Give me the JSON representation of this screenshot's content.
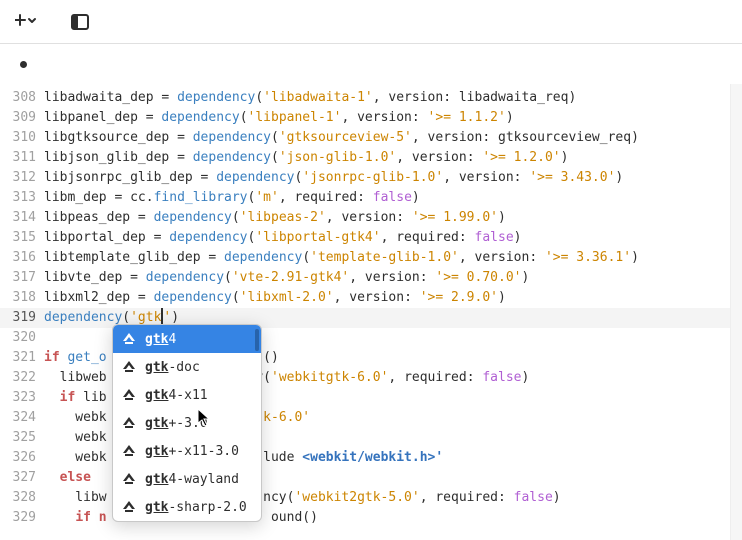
{
  "editor": {
    "lines": [
      {
        "num": 308,
        "tokens": [
          {
            "t": "ident",
            "v": "libadwaita_dep "
          },
          {
            "t": "p",
            "v": "= "
          },
          {
            "t": "fn",
            "v": "dependency"
          },
          {
            "t": "p",
            "v": "("
          },
          {
            "t": "s",
            "v": "'libadwaita-1'"
          },
          {
            "t": "p",
            "v": ", "
          },
          {
            "t": "arglabel",
            "v": "version"
          },
          {
            "t": "p",
            "v": ": "
          },
          {
            "t": "ident",
            "v": "libadwaita_req"
          },
          {
            "t": "p",
            "v": ")"
          }
        ]
      },
      {
        "num": 309,
        "tokens": [
          {
            "t": "ident",
            "v": "libpanel_dep "
          },
          {
            "t": "p",
            "v": "= "
          },
          {
            "t": "fn",
            "v": "dependency"
          },
          {
            "t": "p",
            "v": "("
          },
          {
            "t": "s",
            "v": "'libpanel-1'"
          },
          {
            "t": "p",
            "v": ", "
          },
          {
            "t": "arglabel",
            "v": "version"
          },
          {
            "t": "p",
            "v": ": "
          },
          {
            "t": "s",
            "v": "'>= 1.1.2'"
          },
          {
            "t": "p",
            "v": ")"
          }
        ]
      },
      {
        "num": 310,
        "tokens": [
          {
            "t": "ident",
            "v": "libgtksource_dep "
          },
          {
            "t": "p",
            "v": "= "
          },
          {
            "t": "fn",
            "v": "dependency"
          },
          {
            "t": "p",
            "v": "("
          },
          {
            "t": "s",
            "v": "'gtksourceview-5'"
          },
          {
            "t": "p",
            "v": ", "
          },
          {
            "t": "arglabel",
            "v": "version"
          },
          {
            "t": "p",
            "v": ": "
          },
          {
            "t": "ident",
            "v": "gtksourceview_req"
          },
          {
            "t": "p",
            "v": ")"
          }
        ]
      },
      {
        "num": 311,
        "tokens": [
          {
            "t": "ident",
            "v": "libjson_glib_dep "
          },
          {
            "t": "p",
            "v": "= "
          },
          {
            "t": "fn",
            "v": "dependency"
          },
          {
            "t": "p",
            "v": "("
          },
          {
            "t": "s",
            "v": "'json-glib-1.0'"
          },
          {
            "t": "p",
            "v": ", "
          },
          {
            "t": "arglabel",
            "v": "version"
          },
          {
            "t": "p",
            "v": ": "
          },
          {
            "t": "s",
            "v": "'>= 1.2.0'"
          },
          {
            "t": "p",
            "v": ")"
          }
        ]
      },
      {
        "num": 312,
        "tokens": [
          {
            "t": "ident",
            "v": "libjsonrpc_glib_dep "
          },
          {
            "t": "p",
            "v": "= "
          },
          {
            "t": "fn",
            "v": "dependency"
          },
          {
            "t": "p",
            "v": "("
          },
          {
            "t": "s",
            "v": "'jsonrpc-glib-1.0'"
          },
          {
            "t": "p",
            "v": ", "
          },
          {
            "t": "arglabel",
            "v": "version"
          },
          {
            "t": "p",
            "v": ": "
          },
          {
            "t": "s",
            "v": "'>= 3.43.0'"
          },
          {
            "t": "p",
            "v": ")"
          }
        ]
      },
      {
        "num": 313,
        "tokens": [
          {
            "t": "ident",
            "v": "libm_dep "
          },
          {
            "t": "p",
            "v": "= cc."
          },
          {
            "t": "fn",
            "v": "find_library"
          },
          {
            "t": "p",
            "v": "("
          },
          {
            "t": "s",
            "v": "'m'"
          },
          {
            "t": "p",
            "v": ", "
          },
          {
            "t": "arglabel",
            "v": "required"
          },
          {
            "t": "p",
            "v": ": "
          },
          {
            "t": "n",
            "v": "false"
          },
          {
            "t": "p",
            "v": ")"
          }
        ]
      },
      {
        "num": 314,
        "tokens": [
          {
            "t": "ident",
            "v": "libpeas_dep "
          },
          {
            "t": "p",
            "v": "= "
          },
          {
            "t": "fn",
            "v": "dependency"
          },
          {
            "t": "p",
            "v": "("
          },
          {
            "t": "s",
            "v": "'libpeas-2'"
          },
          {
            "t": "p",
            "v": ", "
          },
          {
            "t": "arglabel",
            "v": "version"
          },
          {
            "t": "p",
            "v": ": "
          },
          {
            "t": "s",
            "v": "'>= 1.99.0'"
          },
          {
            "t": "p",
            "v": ")"
          }
        ]
      },
      {
        "num": 315,
        "tokens": [
          {
            "t": "ident",
            "v": "libportal_dep "
          },
          {
            "t": "p",
            "v": "= "
          },
          {
            "t": "fn",
            "v": "dependency"
          },
          {
            "t": "p",
            "v": "("
          },
          {
            "t": "s",
            "v": "'libportal-gtk4'"
          },
          {
            "t": "p",
            "v": ", "
          },
          {
            "t": "arglabel",
            "v": "required"
          },
          {
            "t": "p",
            "v": ": "
          },
          {
            "t": "n",
            "v": "false"
          },
          {
            "t": "p",
            "v": ")"
          }
        ]
      },
      {
        "num": 316,
        "tokens": [
          {
            "t": "ident",
            "v": "libtemplate_glib_dep "
          },
          {
            "t": "p",
            "v": "= "
          },
          {
            "t": "fn",
            "v": "dependency"
          },
          {
            "t": "p",
            "v": "("
          },
          {
            "t": "s",
            "v": "'template-glib-1.0'"
          },
          {
            "t": "p",
            "v": ", "
          },
          {
            "t": "arglabel",
            "v": "version"
          },
          {
            "t": "p",
            "v": ": "
          },
          {
            "t": "s",
            "v": "'>= 3.36.1'"
          },
          {
            "t": "p",
            "v": ")"
          }
        ]
      },
      {
        "num": 317,
        "tokens": [
          {
            "t": "ident",
            "v": "libvte_dep "
          },
          {
            "t": "p",
            "v": "= "
          },
          {
            "t": "fn",
            "v": "dependency"
          },
          {
            "t": "p",
            "v": "("
          },
          {
            "t": "s",
            "v": "'vte-2.91-gtk4'"
          },
          {
            "t": "p",
            "v": ", "
          },
          {
            "t": "arglabel",
            "v": "version"
          },
          {
            "t": "p",
            "v": ": "
          },
          {
            "t": "s",
            "v": "'>= 0.70.0'"
          },
          {
            "t": "p",
            "v": ")"
          }
        ]
      },
      {
        "num": 318,
        "tokens": [
          {
            "t": "ident",
            "v": "libxml2_dep "
          },
          {
            "t": "p",
            "v": "= "
          },
          {
            "t": "fn",
            "v": "dependency"
          },
          {
            "t": "p",
            "v": "("
          },
          {
            "t": "s",
            "v": "'libxml-2.0'"
          },
          {
            "t": "p",
            "v": ", "
          },
          {
            "t": "arglabel",
            "v": "version"
          },
          {
            "t": "p",
            "v": ": "
          },
          {
            "t": "s",
            "v": "'>= 2.9.0'"
          },
          {
            "t": "p",
            "v": ")"
          }
        ]
      },
      {
        "num": 319,
        "cursor": true,
        "tokens": [
          {
            "t": "fn",
            "v": "dependency"
          },
          {
            "t": "p",
            "v": "("
          },
          {
            "t": "s",
            "v": "'gtk"
          },
          {
            "t": "caret",
            "v": ""
          },
          {
            "t": "s",
            "v": "'"
          },
          {
            "t": "p",
            "v": ")"
          }
        ]
      },
      {
        "num": 320,
        "tokens": []
      },
      {
        "num": 321,
        "tokens": [
          {
            "t": "kw",
            "v": "if"
          },
          {
            "t": "p",
            "v": " "
          },
          {
            "t": "fn",
            "v": "get_o"
          },
          {
            "t": "p",
            "v": "               abled()"
          }
        ]
      },
      {
        "num": 322,
        "tokens": [
          {
            "t": "p",
            "v": "  libweb           "
          },
          {
            "t": "p",
            "v": "        y("
          },
          {
            "t": "s",
            "v": "'webkitgtk-6.0'"
          },
          {
            "t": "p",
            "v": ", "
          },
          {
            "t": "arglabel",
            "v": "required"
          },
          {
            "t": "p",
            "v": ": "
          },
          {
            "t": "n",
            "v": "false"
          },
          {
            "t": "p",
            "v": ")"
          }
        ]
      },
      {
        "num": 323,
        "tokens": [
          {
            "t": "p",
            "v": "  "
          },
          {
            "t": "kw",
            "v": "if"
          },
          {
            "t": "p",
            "v": " lib"
          }
        ]
      },
      {
        "num": 324,
        "tokens": [
          {
            "t": "p",
            "v": "    webk           "
          },
          {
            "t": "p",
            "v": "         "
          },
          {
            "t": "s",
            "v": "k-6.0'"
          }
        ]
      },
      {
        "num": 325,
        "tokens": [
          {
            "t": "p",
            "v": "    webk"
          }
        ]
      },
      {
        "num": 326,
        "tokens": [
          {
            "t": "p",
            "v": "    webk           "
          },
          {
            "t": "p",
            "v": "         lude "
          },
          {
            "t": "pre",
            "v": "<webkit/webkit.h>'"
          }
        ]
      },
      {
        "num": 327,
        "tokens": [
          {
            "t": "p",
            "v": "  "
          },
          {
            "t": "kw",
            "v": "else"
          }
        ]
      },
      {
        "num": 328,
        "tokens": [
          {
            "t": "p",
            "v": "    libw           "
          },
          {
            "t": "p",
            "v": "         ncy("
          },
          {
            "t": "s",
            "v": "'webkit2gtk-5.0'"
          },
          {
            "t": "p",
            "v": ", "
          },
          {
            "t": "arglabel",
            "v": "required"
          },
          {
            "t": "p",
            "v": ": "
          },
          {
            "t": "n",
            "v": "false"
          },
          {
            "t": "p",
            "v": ")"
          }
        ]
      },
      {
        "num": 329,
        "tokens": [
          {
            "t": "p",
            "v": "    "
          },
          {
            "t": "kw",
            "v": "if n"
          },
          {
            "t": "p",
            "v": "                     ound()"
          }
        ]
      }
    ]
  },
  "completion": {
    "query": "gtk",
    "items": [
      {
        "pre": "",
        "match": "gtk",
        "post": "4",
        "selected": true
      },
      {
        "pre": "",
        "match": "gtk",
        "post": "-doc"
      },
      {
        "pre": "",
        "match": "gtk",
        "post": "4-x11"
      },
      {
        "pre": "",
        "match": "gtk",
        "post": "+-3.0"
      },
      {
        "pre": "",
        "match": "gtk",
        "post": "+-x11-3.0"
      },
      {
        "pre": "",
        "match": "gtk",
        "post": "4-wayland"
      },
      {
        "pre": "",
        "match": "gtk",
        "post": "-sharp-2.0"
      }
    ]
  }
}
